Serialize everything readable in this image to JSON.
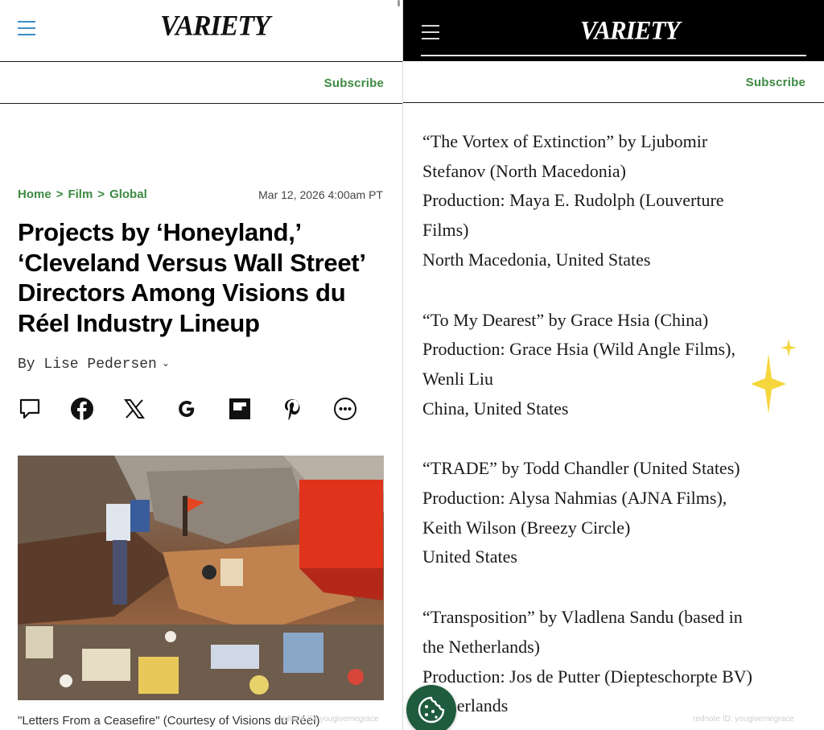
{
  "left": {
    "logo": "VARIETY",
    "subscribe_label": "Subscribe",
    "breadcrumb": [
      {
        "label": "Home"
      },
      {
        "label": "Film"
      },
      {
        "label": "Global"
      }
    ],
    "breadcrumb_separator": ">",
    "date": "Mar 12, 2026 4:00am PT",
    "headline": "Projects by ‘Honeyland,’ ‘Cleveland Versus Wall Street’ Directors Among Visions du Réel Industry Lineup",
    "byline": "By Lise Pedersen",
    "share_icons": [
      "comment-icon",
      "facebook-icon",
      "x-icon",
      "google-icon",
      "flipboard-icon",
      "pinterest-icon",
      "more-icon"
    ],
    "photo_caption": "\"Letters From a Ceasefire\" (Courtesy of Visions du Réel)",
    "watermark": "rednote ID: yougivemegrace"
  },
  "right": {
    "logo": "VARIETY",
    "subscribe_label": "Subscribe",
    "entries": [
      {
        "lines": [
          "“The Vortex of Extinction” by Ljubomir",
          "Stefanov (North Macedonia)",
          "Production: Maya E. Rudolph (Louverture",
          "Films)",
          "North Macedonia, United States"
        ]
      },
      {
        "lines": [
          "“To My Dearest” by Grace Hsia (China)",
          "Production: Grace Hsia (Wild Angle Films),",
          "Wenli Liu",
          "China, United States"
        ]
      },
      {
        "lines": [
          "“TRADE” by Todd Chandler (United States)",
          "Production: Alysa Nahmias (AJNA Films),",
          "Keith Wilson (Breezy Circle)",
          "United States"
        ]
      },
      {
        "lines": [
          "“Transposition” by Vladlena Sandu (based in",
          "the Netherlands)",
          "Production: Jos de Putter (Diepteschorpte BV)",
          "Netherlands"
        ]
      }
    ],
    "watermark": "rednote ID: yougivemegrace",
    "cookie_icon": "cookie-icon"
  },
  "colors": {
    "accent_green": "#3d8a42",
    "hamburger_blue": "#3a8fc6",
    "cookie_green": "#1f5c3d",
    "sparkle_yellow": "#f5d63d"
  }
}
